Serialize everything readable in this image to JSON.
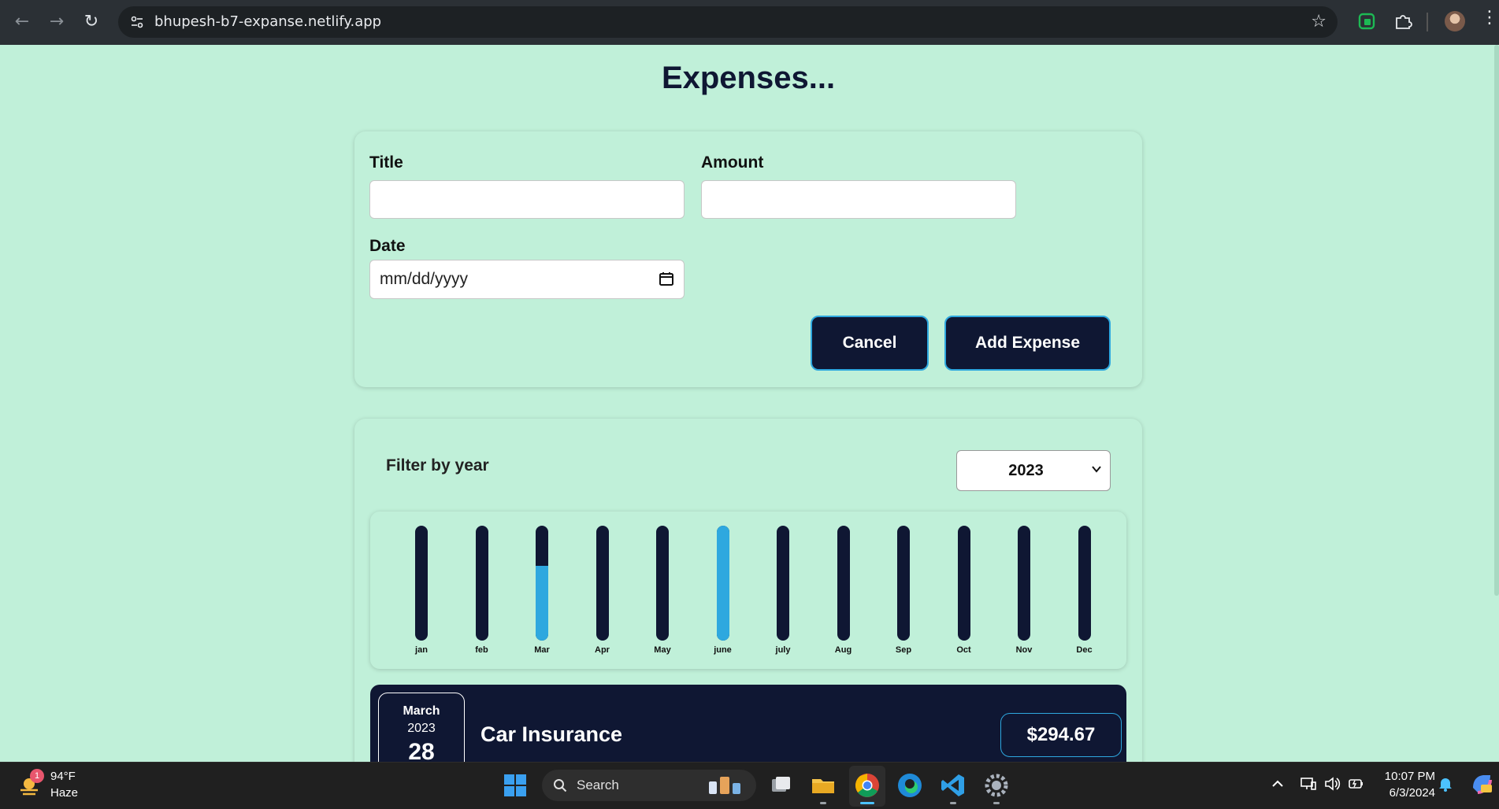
{
  "browser": {
    "url": "bhupesh-b7-expanse.netlify.app",
    "icons": [
      "back-icon",
      "forward-icon",
      "reload-icon",
      "site-info-icon",
      "bookmark-star-icon",
      "extension-icon",
      "puzzle-icon",
      "profile-avatar",
      "more-menu-icon"
    ]
  },
  "page": {
    "heading": "Expenses..."
  },
  "form": {
    "title_label": "Title",
    "title_value": "",
    "amount_label": "Amount",
    "amount_value": "",
    "date_label": "Date",
    "date_placeholder": "mm/dd/yyyy",
    "cancel_label": "Cancel",
    "add_label": "Add Expense"
  },
  "filter": {
    "label": "Filter by year",
    "selected_year": "2023"
  },
  "chart_data": {
    "type": "bar",
    "categories": [
      "jan",
      "feb",
      "Mar",
      "Apr",
      "May",
      "june",
      "july",
      "Aug",
      "Sep",
      "Oct",
      "Nov",
      "Dec"
    ],
    "values": [
      0,
      0,
      0.65,
      0,
      0,
      1.0,
      0,
      0,
      0,
      0,
      0,
      0
    ],
    "value_units": "fraction of max (fill level)",
    "colors": {
      "track": "#0f1733",
      "fill": "#2ea8df"
    }
  },
  "expenses": [
    {
      "month": "March",
      "year": "2023",
      "day": "28",
      "title": "Car Insurance",
      "amount": "$294.67"
    }
  ],
  "taskbar": {
    "weather_badge": "1",
    "weather_temp": "94°F",
    "weather_desc": "Haze",
    "search_label": "Search",
    "time": "10:07 PM",
    "date": "6/3/2024"
  },
  "colors": {
    "page_bg": "#c0f0d9",
    "navy": "#0f1733",
    "accent_blue": "#2ea8df"
  }
}
